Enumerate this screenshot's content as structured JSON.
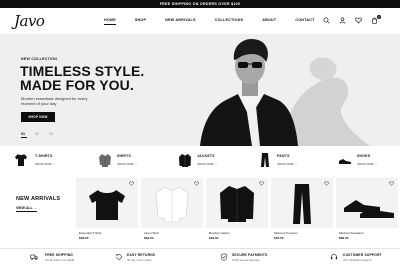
{
  "announcement": {
    "text": "FREE SHIPPING ON ORDERS OVER $100"
  },
  "header": {
    "logo": "Javo",
    "nav": [
      {
        "label": "HOME",
        "active": true
      },
      {
        "label": "SHOP",
        "active": false
      },
      {
        "label": "NEW ARRIVALS",
        "active": false
      },
      {
        "label": "COLLECTIONS",
        "active": false
      },
      {
        "label": "ABOUT",
        "active": false
      },
      {
        "label": "CONTACT",
        "active": false
      }
    ],
    "icons": [
      "search-icon",
      "user-icon",
      "heart-icon",
      "cart-icon"
    ],
    "cart_count": "0"
  },
  "hero": {
    "eyebrow": "NEW COLLECTION",
    "title_line1": "TIMELESS STYLE.",
    "title_line2": "MADE FOR YOU.",
    "subtitle": "Modern essentials designed for every moment of your day.",
    "cta": "SHOP NOW",
    "slides": [
      "01",
      "02",
      "03"
    ],
    "active_slide": "01"
  },
  "categories": [
    {
      "name": "T-SHIRTS",
      "link": "SHOP NOW →",
      "icon": "tshirt-icon"
    },
    {
      "name": "SHIRTS",
      "link": "SHOP NOW →",
      "icon": "shirt-icon"
    },
    {
      "name": "JACKETS",
      "link": "SHOP NOW →",
      "icon": "jacket-icon"
    },
    {
      "name": "PANTS",
      "link": "SHOP NOW →",
      "icon": "pants-icon"
    },
    {
      "name": "SHOES",
      "link": "SHOP NOW →",
      "icon": "shoe-icon"
    }
  ],
  "arrivals": {
    "title": "NEW ARRIVALS",
    "link": "VIEW ALL →",
    "products": [
      {
        "name": "Essential T-Shirt",
        "price": "$39.00",
        "image": "black-tshirt"
      },
      {
        "name": "Linen Shirt",
        "price": "$59.00",
        "image": "white-shirt"
      },
      {
        "name": "Bomber Jacket",
        "price": "$99.00",
        "image": "black-jacket"
      },
      {
        "name": "Tailored Trousers",
        "price": "$79.00",
        "image": "black-trousers"
      },
      {
        "name": "Minimal Sneakers",
        "price": "$89.00",
        "image": "black-sneakers"
      }
    ]
  },
  "features": [
    {
      "title": "FREE SHIPPING",
      "sub": "On all orders over $100",
      "icon": "truck-icon"
    },
    {
      "title": "EASY RETURNS",
      "sub": "30-day return policy",
      "icon": "return-icon"
    },
    {
      "title": "SECURE PAYMENTS",
      "sub": "100% secure payment",
      "icon": "shield-icon"
    },
    {
      "title": "CUSTOMER SUPPORT",
      "sub": "24/7 dedicated support",
      "icon": "headset-icon"
    }
  ]
}
